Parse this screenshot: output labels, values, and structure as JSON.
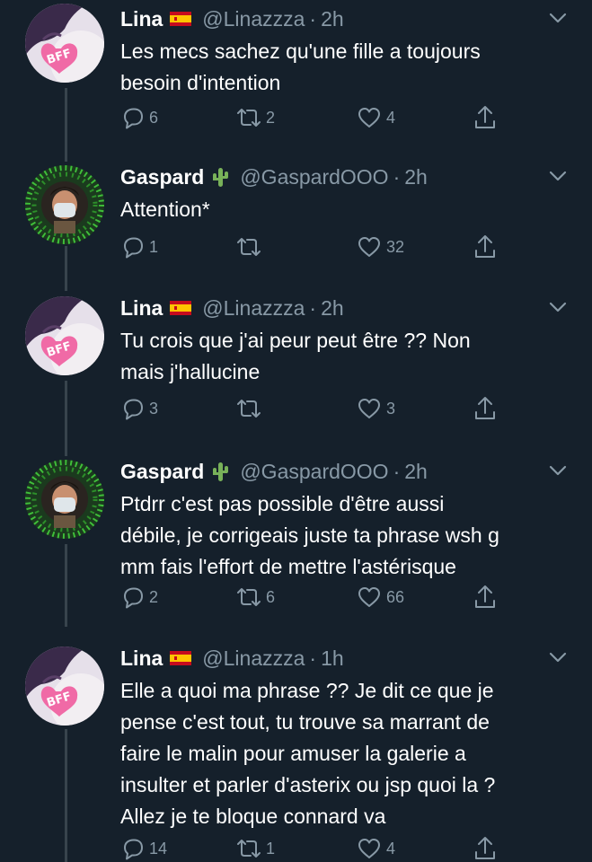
{
  "tweets": [
    {
      "name": "Lina",
      "badge": "spain-flag",
      "handle": "@Linazzza",
      "time": "2h",
      "lines": [
        "Les mecs sachez qu'une fille a toujours",
        "besoin d'intention"
      ],
      "replies": "6",
      "retweets": "2",
      "likes": "4"
    },
    {
      "name": "Gaspard",
      "badge": "cactus",
      "handle": "@GaspardOOO",
      "time": "2h",
      "lines": [
        "Attention*"
      ],
      "replies": "1",
      "retweets": "",
      "likes": "32"
    },
    {
      "name": "Lina",
      "badge": "spain-flag",
      "handle": "@Linazzza",
      "time": "2h",
      "lines": [
        "Tu crois que j'ai peur peut être ?? Non",
        "mais j'hallucine"
      ],
      "replies": "3",
      "retweets": "",
      "likes": "3"
    },
    {
      "name": "Gaspard",
      "badge": "cactus",
      "handle": "@GaspardOOO",
      "time": "2h",
      "lines": [
        "Ptdrr c'est pas possible d'être aussi",
        "débile, je corrigeais juste ta phrase wsh g",
        "mm fais l'effort de mettre l'astérisque"
      ],
      "replies": "2",
      "retweets": "6",
      "likes": "66"
    },
    {
      "name": "Lina",
      "badge": "spain-flag",
      "handle": "@Linazzza",
      "time": "1h",
      "lines": [
        "Elle a quoi ma phrase ?? Je dit ce que je",
        "pense c'est tout, tu trouve sa marrant de",
        "faire le malin pour amuser la galerie a",
        "insulter et parler d'asterix ou jsp quoi la ?",
        "Allez je te bloque connard va"
      ],
      "replies": "14",
      "retweets": "1",
      "likes": "4"
    }
  ],
  "avatar_badge_text": "BFF",
  "icons": {
    "reply": "reply-icon",
    "retweet": "retweet-icon",
    "like": "heart-icon",
    "share": "share-icon",
    "menu": "chevron-down-icon"
  },
  "colors": {
    "background": "#15202b",
    "text": "#ffffff",
    "secondary": "#8899a6",
    "thread_line": "#38444d"
  }
}
